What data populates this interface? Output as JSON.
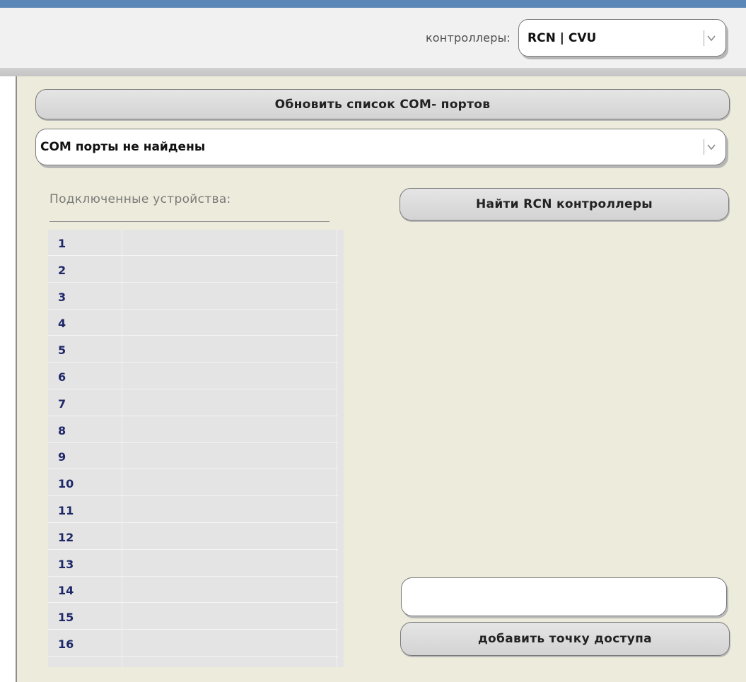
{
  "header": {
    "controllers_label": "контроллеры:",
    "controllers_value": "RCN | CVU"
  },
  "panel": {
    "refresh_button": "Обновить список COM- портов",
    "com_select_value": "COM порты не найдены",
    "devices_label": "Подключенные устройства:",
    "find_button": "Найти RCN  контроллеры",
    "access_point_input_value": "",
    "add_access_point_button": "добавить точку доступа"
  },
  "devices": [
    "1",
    "2",
    "3",
    "4",
    "5",
    "6",
    "7",
    "8",
    "9",
    "10",
    "11",
    "12",
    "13",
    "14",
    "15",
    "16"
  ],
  "colors": {
    "top_bar": "#5b86b8",
    "panel_bg": "#edebdb",
    "row_number": "#1e2868"
  },
  "icons": [
    "chevron-down-icon"
  ]
}
